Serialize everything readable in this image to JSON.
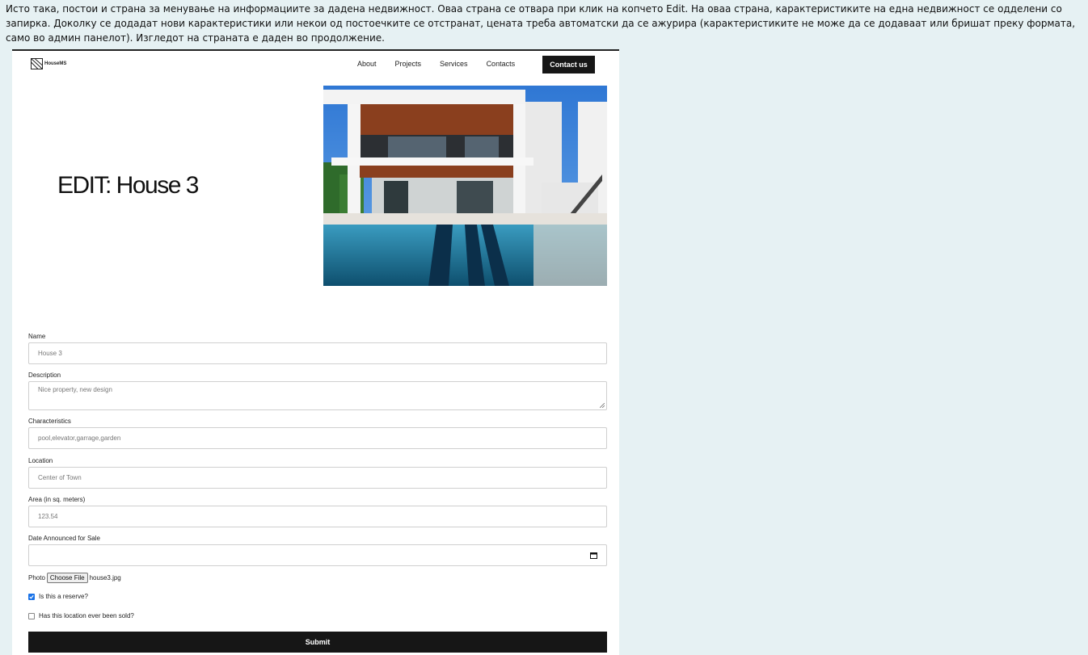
{
  "intro_text": "Исто така, постои и страна за менување на информациите за дадена недвижност. Оваа страна се отвара при клик на копчето Edit. На оваа страна, карактеристиките на една недвижност се одделени со запирка. Доколку се додадат нови карактеристики или некои од постоечките се отстранат, цената треба автоматски да се ажурира (карактеристиките не може да се додаваат или бришат преку формата, само во админ панелот). Изгледот на страната е даден во продолжение.",
  "nav": {
    "logo_text": "HouseMS",
    "links": [
      "About",
      "Projects",
      "Services",
      "Contacts"
    ],
    "cta": "Contact us"
  },
  "hero": {
    "title": "EDIT: House 3"
  },
  "form": {
    "name": {
      "label": "Name",
      "value": "House 3"
    },
    "description": {
      "label": "Description",
      "value": "Nice property, new design"
    },
    "characteristics": {
      "label": "Characteristics",
      "value": "pool,elevator,garrage,garden"
    },
    "location": {
      "label": "Location",
      "value": "Center of Town"
    },
    "area": {
      "label": "Area (in sq. meters)",
      "value": "123.54"
    },
    "date": {
      "label": "Date Announced for Sale",
      "value": ""
    },
    "photo": {
      "label": "Photo",
      "button": "Choose File",
      "filename": "house3.jpg"
    },
    "reserve": {
      "label": "Is this a reserve?",
      "checked": true
    },
    "sold": {
      "label": "Has this location ever been sold?",
      "checked": false
    },
    "submit": "Submit"
  },
  "colors": {
    "page_bg": "#e6f1f3",
    "dark": "#161616",
    "checkbox_accent": "#1a73e8"
  }
}
